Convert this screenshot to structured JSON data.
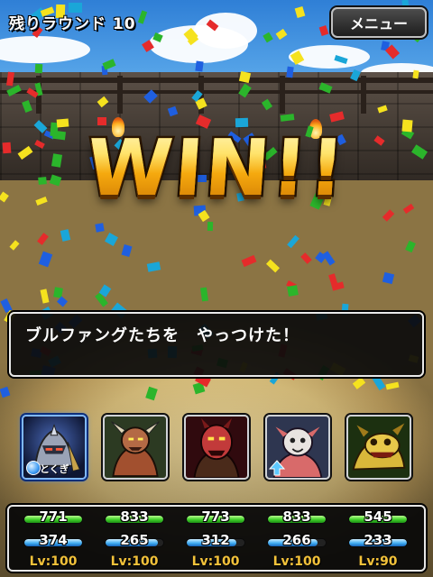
{
  "hud": {
    "round_label": "残りラウンド 10",
    "menu_label": "メニュー"
  },
  "banner": {
    "text": "WIN!!"
  },
  "message": {
    "text": "ブルファングたちを　やっつけた！"
  },
  "party": [
    {
      "name": "portrait-1",
      "tag": "とくぎ",
      "selected": true,
      "colors": [
        "#4a5a8c",
        "#9aa3b6",
        "#1a2040"
      ],
      "icon": "armored-knight-icon"
    },
    {
      "name": "portrait-2",
      "tag": "",
      "selected": false,
      "colors": [
        "#3d5a3a",
        "#b0593c",
        "#1c2416"
      ],
      "icon": "horned-demon-icon"
    },
    {
      "name": "portrait-3",
      "tag": "",
      "selected": false,
      "colors": [
        "#6a1c22",
        "#c23a3a",
        "#2a0a0c"
      ],
      "icon": "red-demon-icon"
    },
    {
      "name": "portrait-4",
      "tag": "",
      "selected": false,
      "colors": [
        "#5a6a8a",
        "#d86a6a",
        "#1e2030"
      ],
      "icon": "masked-beast-icon"
    },
    {
      "name": "portrait-5",
      "tag": "",
      "selected": false,
      "colors": [
        "#2e4e1e",
        "#d9b83a",
        "#142208"
      ],
      "icon": "gold-dragon-icon"
    }
  ],
  "stats": [
    {
      "hp": "771",
      "mp": "374",
      "hp_frac": 1.0,
      "mp_frac": 1.0,
      "level": "Lv:100"
    },
    {
      "hp": "833",
      "mp": "265",
      "hp_frac": 1.0,
      "mp_frac": 0.9,
      "level": "Lv:100"
    },
    {
      "hp": "773",
      "mp": "312",
      "hp_frac": 1.0,
      "mp_frac": 0.86,
      "level": "Lv:100"
    },
    {
      "hp": "833",
      "mp": "266",
      "hp_frac": 1.0,
      "mp_frac": 0.86,
      "level": "Lv:100"
    },
    {
      "hp": "545",
      "mp": "233",
      "hp_frac": 1.0,
      "mp_frac": 1.0,
      "level": "Lv:90"
    }
  ],
  "colors": {
    "win_gold": "#f2b219",
    "hp_green": "#3fcf2a",
    "mp_blue": "#42aef3",
    "level_yellow": "#f3c23a"
  }
}
